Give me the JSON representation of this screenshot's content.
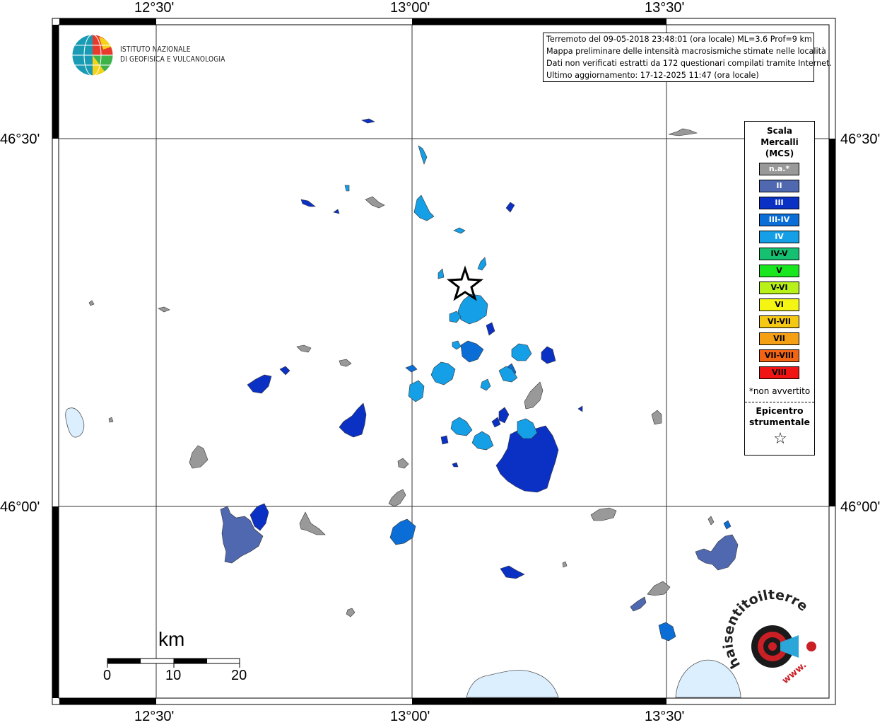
{
  "info": {
    "line1": "Terremoto del 09-05-2018 23:48:01 (ora locale) ML=3.6 Prof=9 km",
    "line2": "Mappa preliminare delle intensità macrosismiche stimate nelle località",
    "line3": "Dati non verificati estratti da 172 questionari compilati tramite Internet.",
    "line4": "Ultimo aggiornamento: 17-12-2025 11:47 (ora locale)"
  },
  "logo": {
    "line1": "ISTITUTO NAZIONALE",
    "line2": "DI GEOFISICA E VULCANOLOGIA"
  },
  "coords": {
    "lon_1230": "12°30'",
    "lon_1300": "13°00'",
    "lon_1330": "13°30'",
    "lat_4630": "46°30'",
    "lat_4600": "46°00'"
  },
  "legend": {
    "title": "Scala\nMercalli\n(MCS)",
    "items": [
      {
        "label": "n.a.*",
        "color": "#999999",
        "text_color": "#ffffff"
      },
      {
        "label": "II",
        "color": "#4f68b0",
        "text_color": "#ffffff"
      },
      {
        "label": "III",
        "color": "#0b31c4",
        "text_color": "#ffffff"
      },
      {
        "label": "III-IV",
        "color": "#0a6ed6",
        "text_color": "#ffffff"
      },
      {
        "label": "IV",
        "color": "#159fe6",
        "text_color": "#ffffff"
      },
      {
        "label": "IV-V",
        "color": "#16c071",
        "text_color": "#000000"
      },
      {
        "label": "V",
        "color": "#19e61e",
        "text_color": "#000000"
      },
      {
        "label": "V-VI",
        "color": "#b8f01a",
        "text_color": "#000000"
      },
      {
        "label": "VI",
        "color": "#f5f514",
        "text_color": "#000000"
      },
      {
        "label": "VI-VII",
        "color": "#f5c814",
        "text_color": "#000000"
      },
      {
        "label": "VII",
        "color": "#f5a014",
        "text_color": "#000000"
      },
      {
        "label": "VII-VIII",
        "color": "#f06414",
        "text_color": "#000000"
      },
      {
        "label": "VIII",
        "color": "#f01414",
        "text_color": "#000000"
      }
    ],
    "note": "*non avvertito",
    "epicenter_label": "Epicentro\nstrumentale",
    "epicenter_symbol": "☆"
  },
  "scale_bar": {
    "unit": "km",
    "ticks": [
      "0",
      "10",
      "20"
    ]
  },
  "brand": {
    "text": "haisentitoilterremoto.it",
    "url": "www."
  }
}
